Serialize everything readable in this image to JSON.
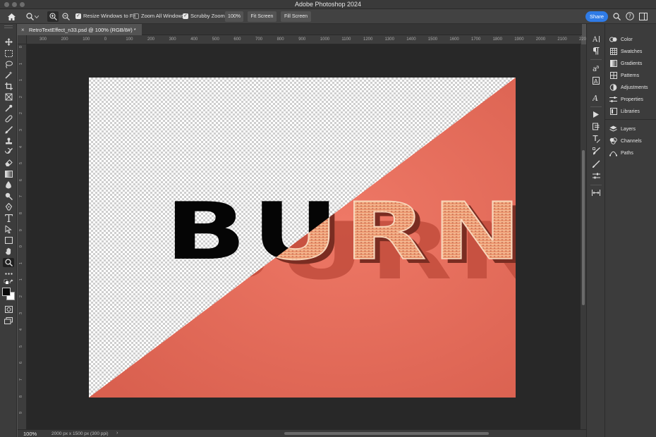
{
  "app": {
    "title": "Adobe Photoshop 2024"
  },
  "options_bar": {
    "resize_windows_label": "Resize Windows to Fit",
    "resize_windows_checked": true,
    "zoom_all_label": "Zoom All Windows",
    "zoom_all_checked": false,
    "scrubby_zoom_label": "Scrubby Zoom",
    "scrubby_zoom_checked": true,
    "zoom_100_label": "100%",
    "fit_screen_label": "Fit Screen",
    "fill_screen_label": "Fill Screen",
    "share_label": "Share"
  },
  "document": {
    "tab_label": "RetroTextEffect_n33.psd @ 100% (RGB/8#) *",
    "canvas_text": "BURN",
    "accent_color": "#e8705e",
    "text_color": "#050505"
  },
  "rulers": {
    "horizontal": [
      "300",
      "200",
      "100",
      "0",
      "100",
      "200",
      "300",
      "400",
      "500",
      "600",
      "700",
      "800",
      "900",
      "1000",
      "1100",
      "1200",
      "1300",
      "1400",
      "1500",
      "1600",
      "1700",
      "1800",
      "1900",
      "2000",
      "2100",
      "220"
    ],
    "vertical": [
      "0",
      "1",
      "1",
      "2",
      "2",
      "3",
      "4",
      "5",
      "6",
      "7",
      "8",
      "9",
      "0",
      "1",
      "1",
      "2",
      "3",
      "4",
      "5",
      "6",
      "7",
      "8",
      "9"
    ]
  },
  "status": {
    "zoom": "100%",
    "doc_info": "2000 px x 1500 px (300 ppi)"
  },
  "panels": [
    {
      "label": "Color",
      "icon": "color-icon"
    },
    {
      "label": "Swatches",
      "icon": "swatches-icon"
    },
    {
      "label": "Gradients",
      "icon": "gradients-icon"
    },
    {
      "label": "Patterns",
      "icon": "patterns-icon"
    },
    {
      "label": "Adjustments",
      "icon": "adjustments-icon"
    },
    {
      "label": "Properties",
      "icon": "properties-icon"
    },
    {
      "label": "Libraries",
      "icon": "libraries-icon"
    },
    {
      "label": "Layers",
      "icon": "layers-icon"
    },
    {
      "label": "Channels",
      "icon": "channels-icon"
    },
    {
      "label": "Paths",
      "icon": "paths-icon"
    }
  ]
}
